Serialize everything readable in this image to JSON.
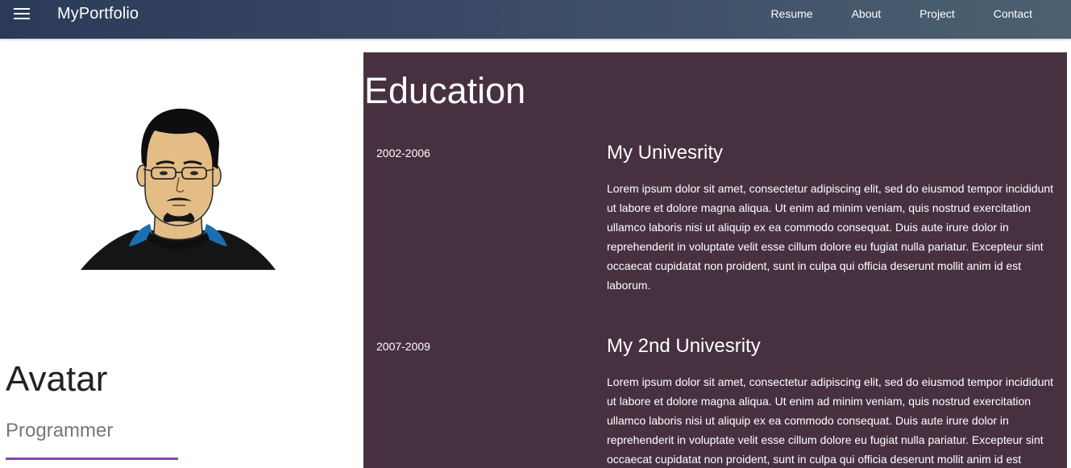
{
  "navbar": {
    "brand": "MyPortfolio",
    "links": [
      "Resume",
      "About",
      "Project",
      "Contact"
    ],
    "menu_icon": "hamburger-menu-icon",
    "colors": {
      "gradient_start": "#2b3a58",
      "gradient_end": "#4b6070"
    }
  },
  "profile": {
    "name": "Avatar",
    "role": "Programmer",
    "image": "avatar-illustration",
    "accent": "#8a44b0"
  },
  "education": {
    "title": "Education",
    "background": "#473140",
    "entries": [
      {
        "years": "2002-2006",
        "school": "My Univesrity",
        "description": "Lorem ipsum dolor sit amet, consectetur adipiscing elit, sed do eiusmod tempor incididunt ut labore et dolore magna aliqua. Ut enim ad minim veniam, quis nostrud exercitation ullamco laboris nisi ut aliquip ex ea commodo consequat. Duis aute irure dolor in reprehenderit in voluptate velit esse cillum dolore eu fugiat nulla pariatur. Excepteur sint occaecat cupidatat non proident, sunt in culpa qui officia deserunt mollit anim id est laborum."
      },
      {
        "years": "2007-2009",
        "school": "My 2nd Univesrity",
        "description": "Lorem ipsum dolor sit amet, consectetur adipiscing elit, sed do eiusmod tempor incididunt ut labore et dolore magna aliqua. Ut enim ad minim veniam, quis nostrud exercitation ullamco laboris nisi ut aliquip ex ea commodo consequat. Duis aute irure dolor in reprehenderit in voluptate velit esse cillum dolore eu fugiat nulla pariatur. Excepteur sint occaecat cupidatat non proident, sunt in culpa qui officia deserunt mollit anim id est laborum."
      }
    ]
  }
}
